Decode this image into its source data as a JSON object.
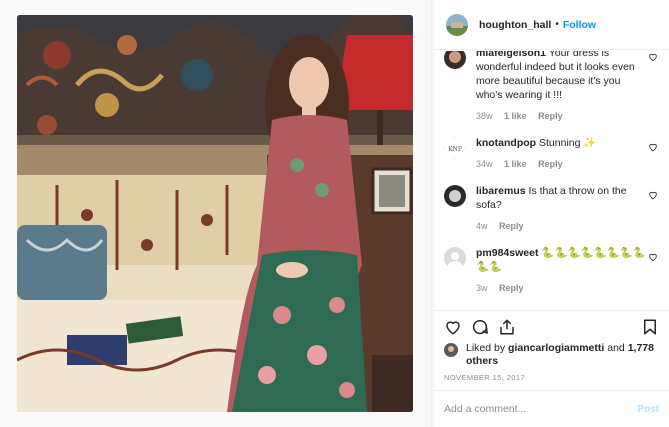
{
  "post": {
    "username": "houghton_hall",
    "dot": "•",
    "follow_label": "Follow"
  },
  "comments": [
    {
      "user": "mlafelgelson1",
      "text": "Your dress is wonderful indeed but it looks even more beautiful because it's you who's wearing it !!!",
      "time": "38w",
      "likes": "1 like",
      "reply": "Reply"
    },
    {
      "user": "knotandpop",
      "text": "Stunning ✨",
      "time": "34w",
      "likes": "1 like",
      "reply": "Reply"
    },
    {
      "user": "libaremus",
      "text": "Is that a throw on the sofa?",
      "time": "4w",
      "reply": "Reply"
    },
    {
      "user": "pm984sweet",
      "text": "🐍🐍🐍🐍🐍🐍🐍🐍🐍🐍",
      "time": "3w",
      "reply": "Reply"
    }
  ],
  "likes": {
    "prefix": "Liked by",
    "user": "giancarlogiammetti",
    "and": "and",
    "others": "1,778 others"
  },
  "date": "NOVEMBER 15, 2017",
  "add_comment": {
    "placeholder": "Add a comment...",
    "post_label": "Post"
  },
  "icons": {
    "like": "heart-icon",
    "comment": "comment-icon",
    "share": "share-icon",
    "save": "bookmark-icon"
  },
  "colors": {
    "link": "#0095f6",
    "muted": "#8e8e8e",
    "post_disabled": "#b2dffc"
  }
}
